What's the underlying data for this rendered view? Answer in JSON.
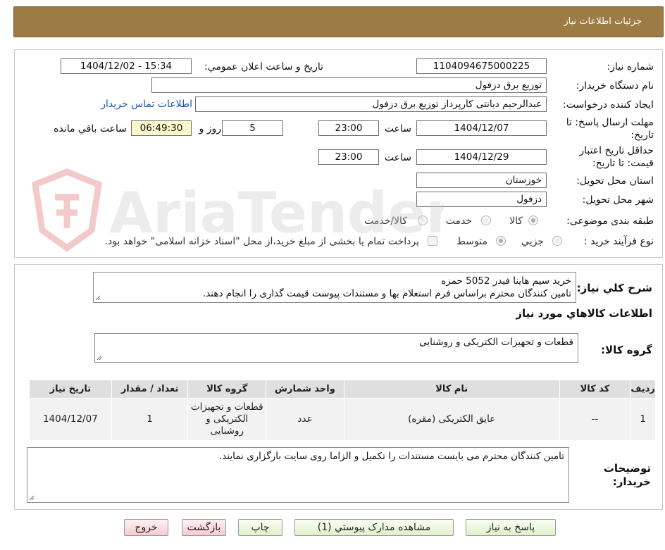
{
  "header": {
    "title": "جزئیات اطلاعات نیاز"
  },
  "form": {
    "need_number_label": "شماره نیاز:",
    "need_number": "1104094675000225",
    "announce_label": "تاریخ و ساعت اعلان عمومي:",
    "announce_value": "1404/12/02 - 15:34",
    "buyer_org_label": "نام دستگاه خریدار:",
    "buyer_org": "توزیع برق دزفول",
    "requester_label": "ایجاد کننده درخواست:",
    "requester": "عبدالرحیم دیانتی کارپرداز توزیع برق دزفول",
    "contact_link": "اطلاعات تماس خریدار",
    "deadline_label_1": "مهلت ارسال پاسخ: تا",
    "deadline_label_2": "تاریخ:",
    "deadline_date": "1404/12/07",
    "time_label": "ساعت",
    "deadline_time": "23:00",
    "days_value": "5",
    "days_label": "روز و",
    "remaining_time": "06:49:30",
    "remaining_label": "ساعت باقي مانده",
    "validity_label_1": "حداقل تاریخ اعتبار",
    "validity_label_2": "قیمت: تا تاریخ:",
    "validity_date": "1404/12/29",
    "validity_time_label": "ساعت",
    "validity_time": "23:00",
    "province_label": "استان محل تحویل:",
    "province": "خوزستان",
    "city_label": "شهر محل تحویل:",
    "city": "دزفول",
    "category_label": "طبقه بندی موضوعی:",
    "category_options": [
      "کالا",
      "خدمت",
      "کالا/خدمت"
    ],
    "process_label": "نوع فرآیند خرید :",
    "process_options": [
      "جزیي",
      "متوسط"
    ],
    "payment_note": "پرداخت تمام یا بخشی از مبلغ خرید،از محل \"اسناد خزانه اسلامی\" خواهد بود."
  },
  "description": {
    "label": "شرح کلي نياز:",
    "line1": "خرید سیم هاینا فیدر 5052 حمزه",
    "line2": "تامین کنندگان محترم براساس فرم استعلام بها و مستندات پیوست قیمت گذاری را انجام دهند."
  },
  "goods": {
    "section_title": "اطلاعات کالاهاي مورد نياز",
    "group_label": "گروه کالا:",
    "group_value": "قطعات و تجهیزات الکتریکی و روشنایی",
    "columns": [
      "رديف",
      "کد کالا",
      "نام کالا",
      "واحد شمارش",
      "گروه کالا",
      "تعداد / مقدار",
      "تاریخ نیاز"
    ],
    "rows": [
      [
        "1",
        "--",
        "عایق الکتریکی (مقره)",
        "عدد",
        "قطعات و تجهیزات الکتریکی و روشنایی",
        "1",
        "1404/12/07"
      ]
    ]
  },
  "buyer_notes": {
    "label_1": "توضیحات",
    "label_2": "خریدار:",
    "text": "تامین کنندگان محترم می بایست مستندات را تکمیل و الزاما روی سایت بارگزاری نمایند."
  },
  "buttons": {
    "respond": "پاسخ به نیاز",
    "view_docs": "مشاهده مدارک پیوستي (1)",
    "print": "چاپ",
    "back": "بازگشت",
    "exit": "خروج"
  },
  "watermark": {
    "text": "AriaTender.neT"
  }
}
